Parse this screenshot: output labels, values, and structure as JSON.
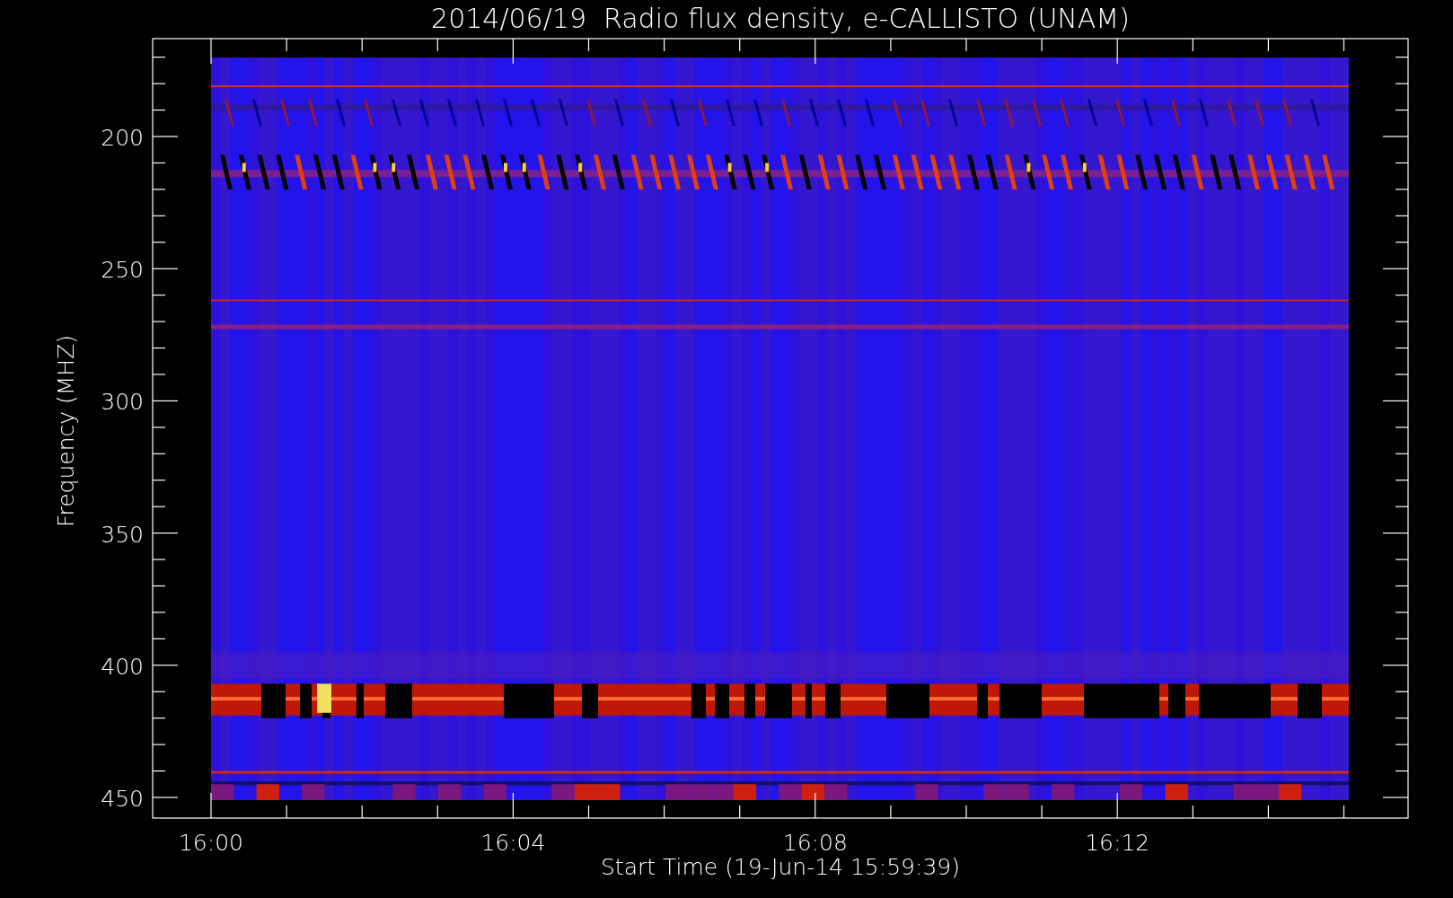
{
  "title": "2014/06/19  Radio flux density, e-CALLISTO (UNAM)",
  "y_axis": {
    "label": "Frequency (MHZ)",
    "ticks": [
      "200",
      "250",
      "300",
      "350",
      "400",
      "450"
    ]
  },
  "x_axis": {
    "label": "Start Time (19-Jun-14 15:59:39)",
    "ticks": [
      "16:00",
      "16:04",
      "16:08",
      "16:12"
    ]
  }
}
